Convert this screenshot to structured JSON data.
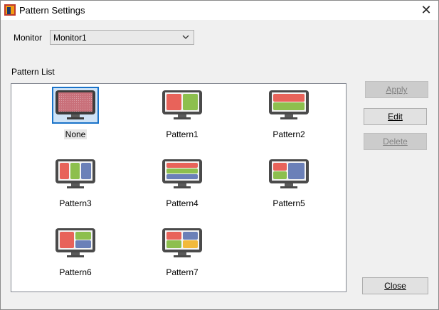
{
  "window": {
    "title": "Pattern Settings"
  },
  "monitor": {
    "label": "Monitor",
    "selected": "Monitor1"
  },
  "pattern_list": {
    "label": "Pattern List",
    "items": [
      {
        "label": "None"
      },
      {
        "label": "Pattern1"
      },
      {
        "label": "Pattern2"
      },
      {
        "label": "Pattern3"
      },
      {
        "label": "Pattern4"
      },
      {
        "label": "Pattern5"
      },
      {
        "label": "Pattern6"
      },
      {
        "label": "Pattern7"
      }
    ],
    "selected_index": 0
  },
  "buttons": {
    "apply": "Apply",
    "edit": "Edit",
    "delete": "Delete",
    "close": "Close"
  },
  "colors": {
    "red": "#e8635a",
    "green": "#8dbf4e",
    "blue": "#6b80b8",
    "yellow": "#f1b93b",
    "selection_border": "#1a73c9"
  }
}
